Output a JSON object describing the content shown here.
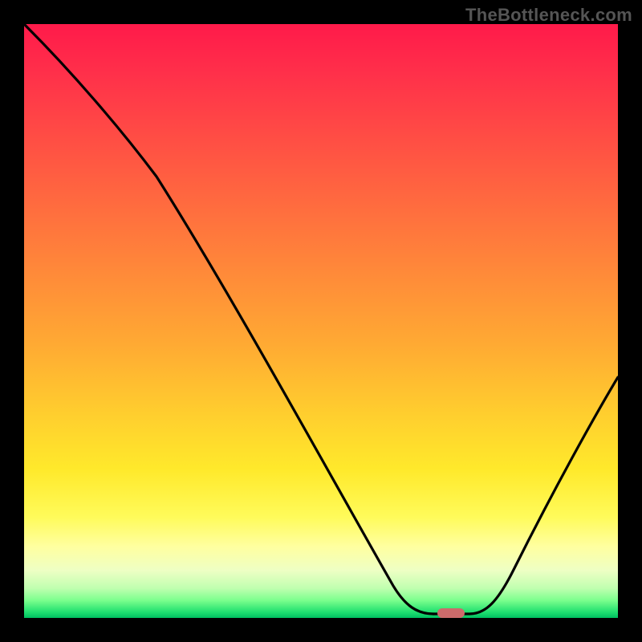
{
  "watermark": "TheBottleneck.com",
  "colors": {
    "background_border": "#000000",
    "curve": "#000000",
    "marker": "#cc6b6b",
    "gradient_top": "#ff1a4a",
    "gradient_mid": "#ffe92b",
    "gradient_bottom": "#00c060"
  },
  "chart_data": {
    "type": "line",
    "title": "",
    "xlabel": "",
    "ylabel": "",
    "xlim": [
      0,
      100
    ],
    "ylim": [
      0,
      100
    ],
    "series": [
      {
        "name": "bottleneck-curve",
        "x": [
          0,
          10,
          22,
          30,
          40,
          50,
          58,
          64,
          69,
          72,
          75,
          80,
          86,
          92,
          100
        ],
        "values": [
          100,
          88,
          74,
          64,
          50,
          34,
          20,
          10,
          3,
          1,
          1,
          6,
          18,
          30,
          41
        ]
      }
    ],
    "annotations": [
      {
        "name": "optimum",
        "x": 72,
        "y": 1,
        "shape": "rounded-bar",
        "color": "#cc6b6b"
      }
    ],
    "background": {
      "style": "vertical-gradient",
      "meaning": "red=high bottleneck, green=low bottleneck",
      "stops": [
        {
          "pos": 0.0,
          "color": "#ff1a4a"
        },
        {
          "pos": 0.5,
          "color": "#ffaa33"
        },
        {
          "pos": 0.83,
          "color": "#fffb5a"
        },
        {
          "pos": 1.0,
          "color": "#00c060"
        }
      ]
    }
  }
}
